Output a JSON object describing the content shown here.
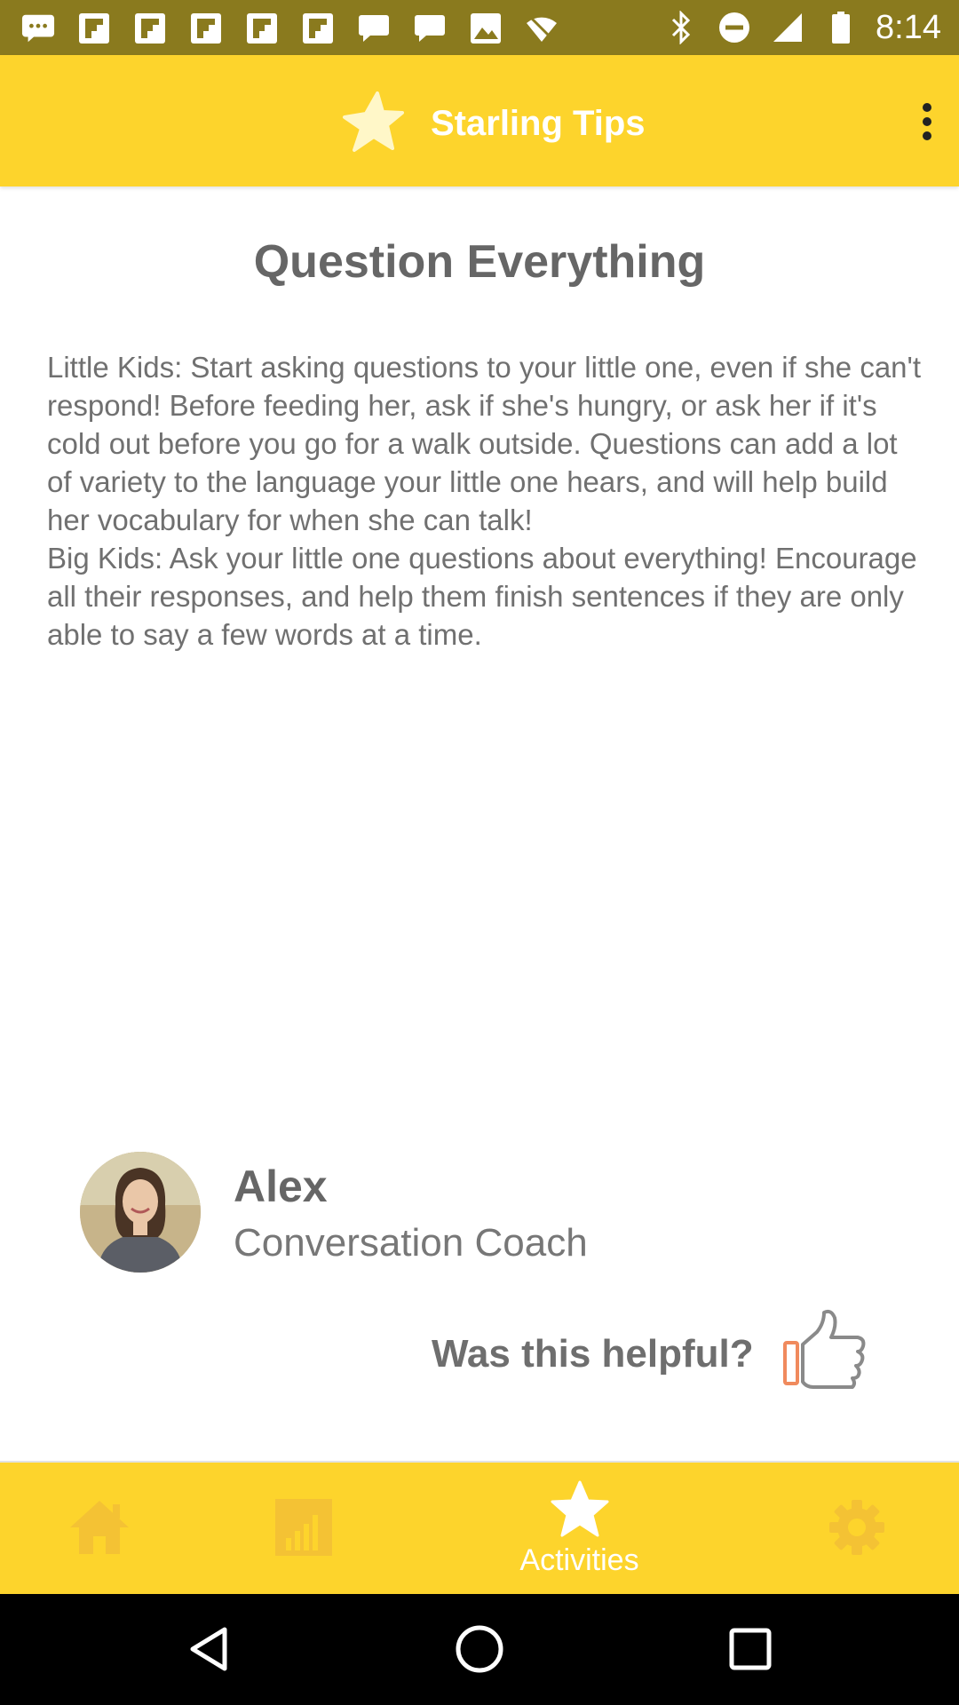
{
  "status_bar": {
    "time": "8:14",
    "left_icons": [
      "chat-icon",
      "flipboard-icon",
      "flipboard-icon",
      "flipboard-icon",
      "flipboard-icon",
      "flipboard-icon",
      "chat-icon",
      "chat-icon",
      "image-icon",
      "wifi-off-icon"
    ],
    "right_icons": [
      "bluetooth-icon",
      "do-not-disturb-icon",
      "signal-icon",
      "battery-icon"
    ],
    "background": "#8a7a1e"
  },
  "app_bar": {
    "title": "Starling Tips",
    "logo_icon": "star-icon",
    "menu_icon": "more-vert-icon",
    "background": "#fdd42c"
  },
  "tip": {
    "title": "Question Everything",
    "paragraphs": [
      "Little Kids: Start asking questions to your little one, even if she can't respond! Before feeding her, ask if she's hungry, or ask her if it's cold out before you go for a walk outside. Questions can add a lot of variety to the language your little one hears, and will help build her vocabulary for when she can talk!",
      "Big Kids: Ask your little one questions about everything! Encourage all their responses, and help them finish sentences if they are only able to say a few words at a time."
    ]
  },
  "coach": {
    "name": "Alex",
    "role": "Conversation Coach"
  },
  "feedback": {
    "prompt": "Was this helpful?",
    "icon": "thumbs-up-icon"
  },
  "bottom_nav": {
    "items": [
      {
        "icon": "home-icon",
        "label": ""
      },
      {
        "icon": "bar-chart-icon",
        "label": ""
      },
      {
        "icon": "star-icon",
        "label": "Activities",
        "active": true
      },
      {
        "icon": "gear-icon",
        "label": ""
      }
    ]
  },
  "system_nav": {
    "buttons": [
      "back-icon",
      "home-circle-icon",
      "recents-icon"
    ]
  },
  "colors": {
    "accent_yellow": "#fdd42c",
    "text_gray": "#666666",
    "thumb_orange": "#f08a5d"
  }
}
